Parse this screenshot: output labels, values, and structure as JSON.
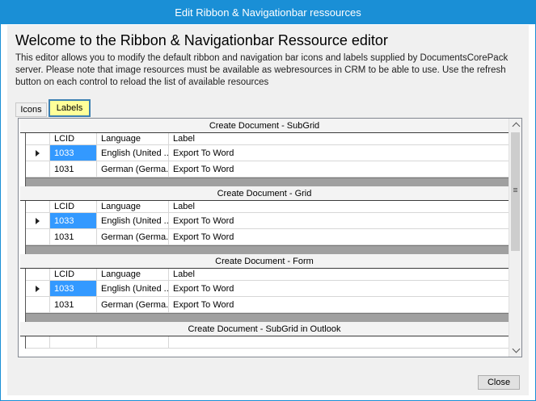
{
  "window": {
    "title": "Edit Ribbon & Navigationbar ressources"
  },
  "heading": "Welcome to the Ribbon & Navigationbar Ressource editor",
  "description": "This editor allows you to modify the default ribbon and navigation bar icons and labels supplied by DocumentsCorePack server. Please note that image resources must be available as webresources in CRM to be able to use. Use the refresh button on each control to reload the list of available resources",
  "tabs": [
    {
      "label": "Icons"
    },
    {
      "label": "Labels"
    }
  ],
  "columns": {
    "lcid": "LCID",
    "language": "Language",
    "label": "Label"
  },
  "sections": [
    {
      "title": "Create Document - SubGrid",
      "rows": [
        {
          "lcid": "1033",
          "language": "English (United ...",
          "label": "Export To Word"
        },
        {
          "lcid": "1031",
          "language": "German (Germa...",
          "label": "Export To Word"
        }
      ]
    },
    {
      "title": "Create Document - Grid",
      "rows": [
        {
          "lcid": "1033",
          "language": "English (United ...",
          "label": "Export To Word"
        },
        {
          "lcid": "1031",
          "language": "German (Germa...",
          "label": "Export To Word"
        }
      ]
    },
    {
      "title": "Create Document - Form",
      "rows": [
        {
          "lcid": "1033",
          "language": "English (United ...",
          "label": "Export To Word"
        },
        {
          "lcid": "1031",
          "language": "German (Germa...",
          "label": "Export To Word"
        }
      ]
    },
    {
      "title": "Create Document - SubGrid in Outlook"
    }
  ],
  "buttons": {
    "close": "Close"
  },
  "colors": {
    "titlebar": "#1a8fd6",
    "selected_cell": "#3399ff",
    "active_tab": "#ffff99"
  },
  "icons": {
    "row_selector": "triangle-right-icon",
    "scroll_up": "chevron-up-icon",
    "scroll_down": "chevron-down-icon"
  }
}
